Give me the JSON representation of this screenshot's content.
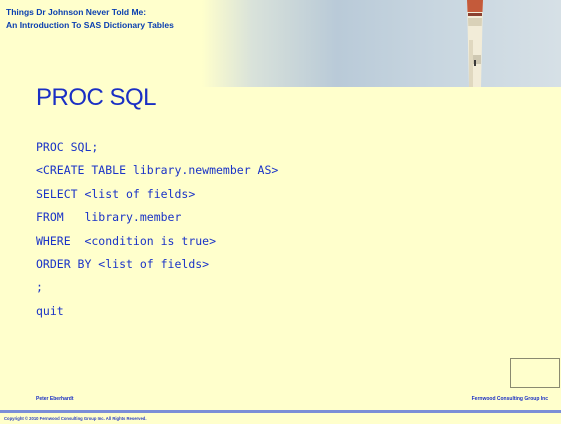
{
  "header": {
    "title_line1": "Things Dr Johnson Never Told Me:",
    "title_line2": "An Introduction To SAS Dictionary Tables"
  },
  "slide": {
    "title": "PROC SQL",
    "code_lines": [
      "PROC SQL;",
      "<CREATE TABLE library.newmember AS>",
      "SELECT <list of fields>",
      "FROM   library.member",
      "WHERE  <condition is true>",
      "ORDER BY <list of fields>",
      ";",
      "quit"
    ]
  },
  "footer": {
    "author": "Peter Eberhardt",
    "company": "Fernwood Consulting Group Inc",
    "copyright": "Copyright © 2010 Fernwood Consulting Group Inc. All Rights Reserved."
  },
  "colors": {
    "background": "#ffffcc",
    "text_blue": "#1a33c7",
    "header_blue": "#0a3fb0"
  },
  "icons": {
    "header_image": "lighthouse-image"
  }
}
